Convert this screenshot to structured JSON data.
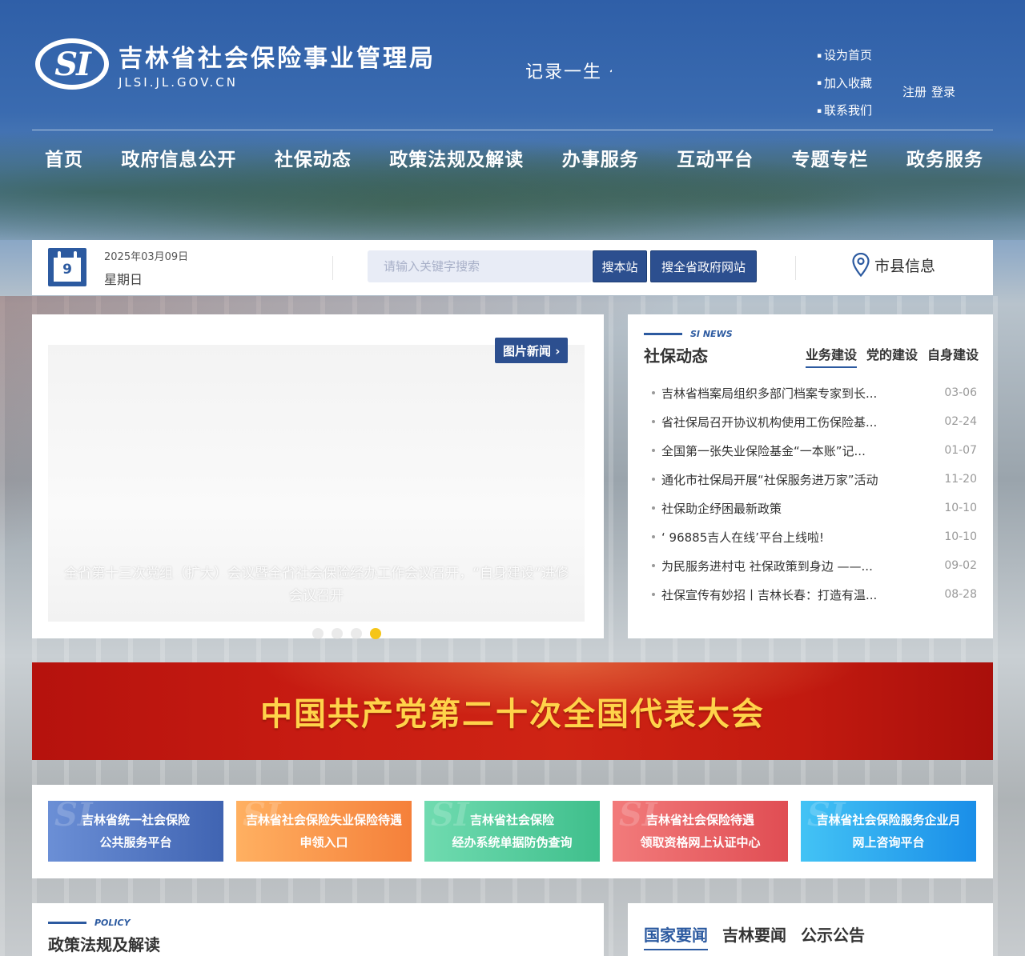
{
  "header": {
    "logo_mark": "SI",
    "org_name": "吉林省社会保险事业管理局",
    "domain": "JLSI.JL.GOV.CN",
    "slogan": "记录一生 亻",
    "quick_links": [
      "设为首页",
      "加入收藏",
      "联系我们"
    ],
    "register": "注册",
    "login": "登录"
  },
  "nav": [
    "首页",
    "政府信息公开",
    "社保动态",
    "政策法规及解读",
    "办事服务",
    "互动平台",
    "专题专栏",
    "政务服务"
  ],
  "infobar": {
    "day": "9",
    "date": "2025年03月09日",
    "weekday": "星期日",
    "search_placeholder": "请输入关键字搜索",
    "search_site": "搜本站",
    "search_province": "搜全省政府网站",
    "city_info": "市县信息"
  },
  "photo_news": {
    "tag": "图片新闻 ›",
    "caption": "全省第十三次党组（扩大）会议暨全省社会保险经办工作会议召开，“自身建设”进修会议召开",
    "slide_count": 4,
    "active_slide": 4
  },
  "si_news": {
    "en_label": "SI NEWS",
    "title": "社保动态",
    "tabs": [
      "业务建设",
      "党的建设",
      "自身建设"
    ],
    "active_tab": "业务建设",
    "items": [
      {
        "title": "吉林省档案局组织多部门档案专家到长...",
        "date": "03-06"
      },
      {
        "title": "省社保局召开协议机构使用工伤保险基...",
        "date": "02-24"
      },
      {
        "title": "全国第一张失业保险基金“一本账”记...",
        "date": "01-07"
      },
      {
        "title": "通化市社保局开展“社保服务进万家”活动",
        "date": "11-20"
      },
      {
        "title": "社保助企纾困最新政策",
        "date": "10-10"
      },
      {
        "title": "‘ 96885吉人在线’平台上线啦!",
        "date": "10-10"
      },
      {
        "title": "为民服务进村屯 社保政策到身边 ——...",
        "date": "09-02"
      },
      {
        "title": "社保宣传有妙招丨吉林长春：打造有温...",
        "date": "08-28"
      }
    ]
  },
  "banner": {
    "text": "中国共产党第二十次全国代表大会"
  },
  "service_cards": [
    {
      "line1": "吉林省统一社会保险",
      "line2": "公共服务平台",
      "color": "#4f74c1"
    },
    {
      "line1": "吉林省社会保险失业保险待遇",
      "line2": "申领入口",
      "color": "#f7954a"
    },
    {
      "line1": "吉林省社会保险",
      "line2": "经办系统单据防伪查询",
      "color": "#4ec99a"
    },
    {
      "line1": "吉林省社会保险待遇",
      "line2": "领取资格网上认证中心",
      "color": "#e85a5e"
    },
    {
      "line1": "吉林省社会保险服务企业月",
      "line2": "网上咨询平台",
      "color": "#22a6f0"
    }
  ],
  "policy": {
    "en_label": "POLICY",
    "title": "政策法规及解读"
  },
  "news_tabs": {
    "items": [
      "国家要闻",
      "吉林要闻",
      "公示公告"
    ],
    "active": "国家要闻"
  },
  "colors": {
    "brand_blue": "#2c5aa0",
    "banner_red": "#c81c12",
    "banner_gold": "#ffd34a",
    "slider_active": "#f5c518"
  }
}
